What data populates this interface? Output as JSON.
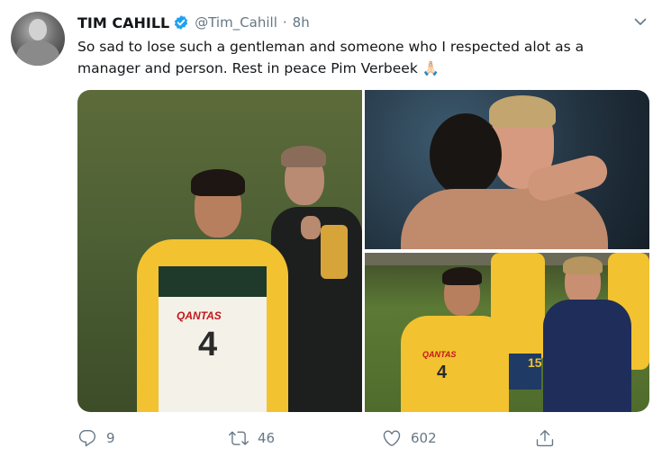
{
  "tweet": {
    "display_name": "TIM CAHILL",
    "handle": "@Tim_Cahill",
    "separator": "·",
    "time": "8h",
    "text": "So sad to lose such a gentleman and someone who I respected alot as a manager and person. Rest in peace Pim Verbeek 🙏🏻",
    "verified": true
  },
  "photos": [
    {
      "alt_icon": "photo-cahill-training"
    },
    {
      "alt_icon": "photo-embrace"
    },
    {
      "alt_icon": "photo-smiling-training"
    }
  ],
  "shirt": {
    "sponsor": "QANTAS",
    "number": "4",
    "number_2": "15"
  },
  "actions": {
    "reply_count": "9",
    "retweet_count": "46",
    "like_count": "602"
  },
  "colors": {
    "verified": "#1da1f2",
    "muted": "#657786",
    "text": "#14171a",
    "jersey_gold": "#f2c230",
    "jersey_green": "#1f3a2a"
  }
}
